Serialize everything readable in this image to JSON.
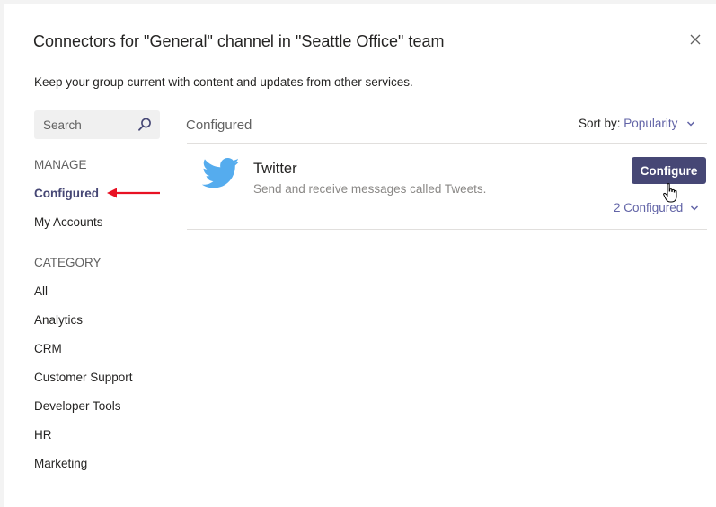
{
  "dialog": {
    "title": "Connectors for \"General\" channel in \"Seattle Office\" team",
    "subtitle": "Keep your group current with content and updates from other services."
  },
  "sidebar": {
    "search_placeholder": "Search",
    "manage_header": "MANAGE",
    "manage_items": [
      "Configured",
      "My Accounts"
    ],
    "category_header": "CATEGORY",
    "category_items": [
      "All",
      "Analytics",
      "CRM",
      "Customer Support",
      "Developer Tools",
      "HR",
      "Marketing"
    ]
  },
  "main": {
    "header": "Configured",
    "sort_label": "Sort by:",
    "sort_value": "Popularity",
    "connectors": [
      {
        "name": "Twitter",
        "description": "Send and receive messages called Tweets.",
        "button_label": "Configure",
        "configured_count": "2 Configured"
      }
    ]
  },
  "colors": {
    "accent": "#6264a7",
    "button": "#464775",
    "twitter_blue": "#55acee",
    "annotation_red": "#e81123"
  },
  "icons": [
    "close-icon",
    "search-icon",
    "chevron-down-icon",
    "twitter-logo",
    "hand-cursor-icon",
    "red-arrow"
  ]
}
